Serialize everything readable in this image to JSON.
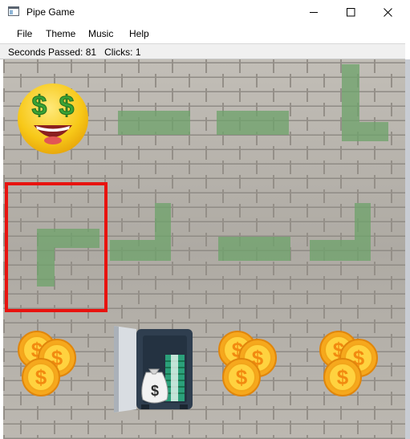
{
  "window": {
    "title": "Pipe Game",
    "icon": "app-window-icon",
    "controls": [
      "minimize-icon",
      "maximize-icon",
      "close-icon"
    ]
  },
  "menu": {
    "items": [
      {
        "label": "File"
      },
      {
        "label": "Theme"
      },
      {
        "label": "Music"
      },
      {
        "label": "Help"
      }
    ]
  },
  "status": {
    "seconds_label": "Seconds Passed:",
    "seconds_value": "81",
    "clicks_label": "Clicks:",
    "clicks_value": "1"
  },
  "board": {
    "rows": 3,
    "cols": 4,
    "background": "brick-wall",
    "selected_cell": {
      "row": 1,
      "col": 0
    },
    "colors": {
      "pipe": "#6fa36b",
      "selection": "#e8130f"
    },
    "cells": [
      [
        {
          "type": "start",
          "icon": "money-eyes-emoji-icon"
        },
        {
          "type": "pipe-horizontal"
        },
        {
          "type": "pipe-horizontal"
        },
        {
          "type": "pipe-corner-up-right"
        }
      ],
      [
        {
          "type": "pipe-corner-right-down"
        },
        {
          "type": "pipe-corner-left-up"
        },
        {
          "type": "pipe-horizontal"
        },
        {
          "type": "pipe-corner-left-up"
        }
      ],
      [
        {
          "type": "decor",
          "icon": "gold-coins-icon"
        },
        {
          "type": "goal",
          "icon": "money-safe-icon"
        },
        {
          "type": "decor",
          "icon": "gold-coins-icon"
        },
        {
          "type": "decor",
          "icon": "gold-coins-icon"
        }
      ]
    ]
  },
  "glyphs": {
    "dollar": "$"
  }
}
